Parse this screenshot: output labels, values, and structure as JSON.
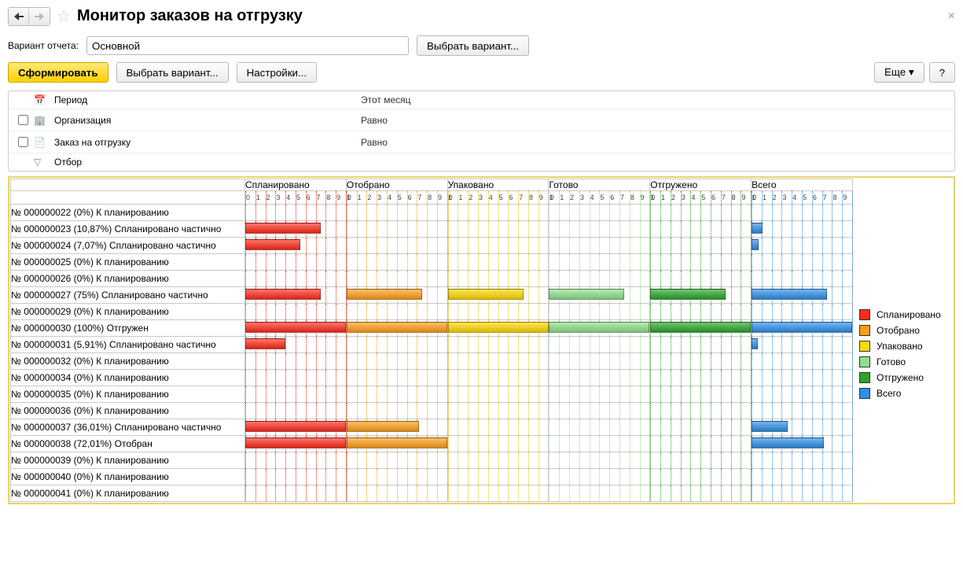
{
  "window": {
    "title": "Монитор заказов на отгрузку"
  },
  "variant": {
    "label": "Вариант отчета:",
    "value": "Основной",
    "choose": "Выбрать вариант..."
  },
  "toolbar": {
    "generate": "Сформировать",
    "choose_variant": "Выбрать вариант...",
    "settings": "Настройки...",
    "more": "Еще",
    "help": "?"
  },
  "filters": [
    {
      "checkbox": false,
      "icon": "calendar",
      "name": "Период",
      "cond": "",
      "value": "Этот месяц"
    },
    {
      "checkbox": true,
      "icon": "org",
      "name": "Организация",
      "cond": "Равно",
      "value": ""
    },
    {
      "checkbox": true,
      "icon": "order",
      "name": "Заказ на отгрузку",
      "cond": "Равно",
      "value": ""
    },
    {
      "checkbox": false,
      "icon": "filter",
      "name": "Отбор",
      "cond": "",
      "value": ""
    }
  ],
  "legend": [
    {
      "label": "Спланировано",
      "color": "#ff2a1a"
    },
    {
      "label": "Отобрано",
      "color": "#ff9e16"
    },
    {
      "label": "Упаковано",
      "color": "#ffd900"
    },
    {
      "label": "Готово",
      "color": "#8fe08a"
    },
    {
      "label": "Отгружено",
      "color": "#2aa52a"
    },
    {
      "label": "Всего",
      "color": "#2d8fe8"
    }
  ],
  "chart_data": {
    "type": "bar",
    "stages": [
      "Спланировано",
      "Отобрано",
      "Упаковано",
      "Готово",
      "Отгружено",
      "Всего"
    ],
    "stage_keys": [
      "plan",
      "pick",
      "pack",
      "ready",
      "ship",
      "total"
    ],
    "tick_range": [
      0,
      100
    ],
    "tick_step": 10,
    "rows": [
      {
        "label": "№ 000000022 (0%) К планированию",
        "plan": 0,
        "pick": 0,
        "pack": 0,
        "ready": 0,
        "ship": 0,
        "total": 0
      },
      {
        "label": "№ 000000023 (10,87%) Спланировано частично",
        "plan": 75,
        "pick": 0,
        "pack": 0,
        "ready": 0,
        "ship": 0,
        "total": 10.87
      },
      {
        "label": "№ 000000024 (7,07%) Спланировано частично",
        "plan": 55,
        "pick": 0,
        "pack": 0,
        "ready": 0,
        "ship": 0,
        "total": 7.07
      },
      {
        "label": "№ 000000025 (0%) К планированию",
        "plan": 0,
        "pick": 0,
        "pack": 0,
        "ready": 0,
        "ship": 0,
        "total": 0
      },
      {
        "label": "№ 000000026 (0%) К планированию",
        "plan": 0,
        "pick": 0,
        "pack": 0,
        "ready": 0,
        "ship": 0,
        "total": 0
      },
      {
        "label": "№ 000000027 (75%) Спланировано частично",
        "plan": 75,
        "pick": 75,
        "pack": 75,
        "ready": 75,
        "ship": 75,
        "total": 75
      },
      {
        "label": "№ 000000029 (0%) К планированию",
        "plan": 0,
        "pick": 0,
        "pack": 0,
        "ready": 0,
        "ship": 0,
        "total": 0
      },
      {
        "label": "№ 000000030 (100%) Отгружен",
        "plan": 100,
        "pick": 100,
        "pack": 100,
        "ready": 100,
        "ship": 100,
        "total": 100
      },
      {
        "label": "№ 000000031 (5,91%) Спланировано частично",
        "plan": 40,
        "pick": 0,
        "pack": 0,
        "ready": 0,
        "ship": 0,
        "total": 5.91
      },
      {
        "label": "№ 000000032 (0%) К планированию",
        "plan": 0,
        "pick": 0,
        "pack": 0,
        "ready": 0,
        "ship": 0,
        "total": 0
      },
      {
        "label": "№ 000000034 (0%) К планированию",
        "plan": 0,
        "pick": 0,
        "pack": 0,
        "ready": 0,
        "ship": 0,
        "total": 0
      },
      {
        "label": "№ 000000035 (0%) К планированию",
        "plan": 0,
        "pick": 0,
        "pack": 0,
        "ready": 0,
        "ship": 0,
        "total": 0
      },
      {
        "label": "№ 000000036 (0%) К планированию",
        "plan": 0,
        "pick": 0,
        "pack": 0,
        "ready": 0,
        "ship": 0,
        "total": 0
      },
      {
        "label": "№ 000000037 (36,01%) Спланировано частично",
        "plan": 100,
        "pick": 72,
        "pack": 0,
        "ready": 0,
        "ship": 0,
        "total": 36.01
      },
      {
        "label": "№ 000000038 (72,01%) Отобран",
        "plan": 100,
        "pick": 100,
        "pack": 0,
        "ready": 0,
        "ship": 0,
        "total": 72.01
      },
      {
        "label": "№ 000000039 (0%) К планированию",
        "plan": 0,
        "pick": 0,
        "pack": 0,
        "ready": 0,
        "ship": 0,
        "total": 0
      },
      {
        "label": "№ 000000040 (0%) К планированию",
        "plan": 0,
        "pick": 0,
        "pack": 0,
        "ready": 0,
        "ship": 0,
        "total": 0
      },
      {
        "label": "№ 000000041 (0%) К планированию",
        "plan": 0,
        "pick": 0,
        "pack": 0,
        "ready": 0,
        "ship": 0,
        "total": 0
      }
    ]
  }
}
